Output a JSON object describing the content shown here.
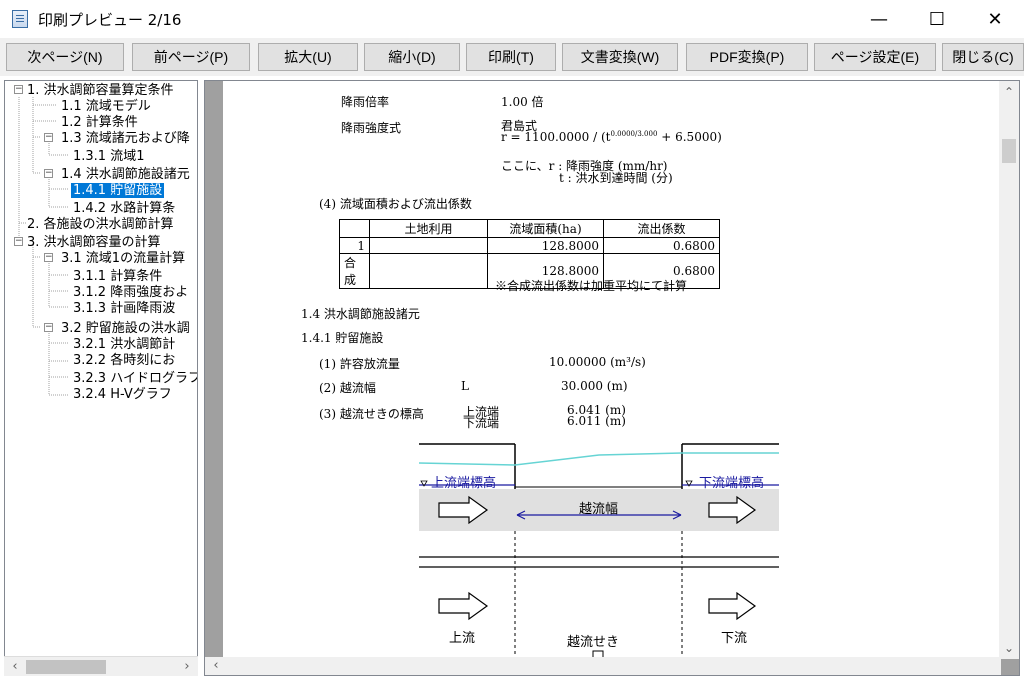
{
  "window": {
    "title": "印刷プレビュー 2/16",
    "controls": {
      "minimize": "—",
      "maximize": "☐",
      "close": "✕"
    }
  },
  "toolbar": {
    "next_page": "次ページ(N)",
    "prev_page": "前ページ(P)",
    "zoom_in": "拡大(U)",
    "zoom_out": "縮小(D)",
    "print": "印刷(T)",
    "doc_convert": "文書変換(W)",
    "pdf_convert": "PDF変換(P)",
    "page_setup": "ページ設定(E)",
    "close": "閉じる(C)"
  },
  "tree": {
    "items": [
      {
        "label": "1. 洪水調節容量算定条件"
      },
      {
        "label": "1.1 流域モデル"
      },
      {
        "label": "1.2 計算条件"
      },
      {
        "label": "1.3 流域諸元および降"
      },
      {
        "label": "1.3.1 流域1"
      },
      {
        "label": "1.4 洪水調節施設諸元"
      },
      {
        "label": "1.4.1 貯留施設"
      },
      {
        "label": "1.4.2 水路計算条"
      },
      {
        "label": "2. 各施設の洪水調節計算"
      },
      {
        "label": "3. 洪水調節容量の計算"
      },
      {
        "label": "3.1 流域1の流量計算"
      },
      {
        "label": "3.1.1 計算条件"
      },
      {
        "label": "3.1.2 降雨強度およ"
      },
      {
        "label": "3.1.3 計画降雨波"
      },
      {
        "label": "3.2 貯留施設の洪水調"
      },
      {
        "label": "3.2.1 洪水調節計"
      },
      {
        "label": "3.2.2 各時刻にお"
      },
      {
        "label": "3.2.3 ハイドログラフ"
      },
      {
        "label": "3.2.4 H-Vグラフ"
      }
    ]
  },
  "doc": {
    "rain_ratio_label": "降雨倍率",
    "rain_ratio_value": "1.00 倍",
    "intensity_label": "降雨強度式",
    "formula_name": "君島式",
    "formula": "r = 1100.0000 / (t",
    "formula_exp": "0.0000/3.000",
    "formula_end": "+     6.5000)",
    "where_r": "ここに、r : 降雨強度 (mm/hr)",
    "where_t": "t : 洪水到達時間 (分)",
    "section4_title": "(4)  流域面積および流出係数",
    "table": {
      "headers": [
        "",
        "土地利用",
        "流域面積(ha)",
        "流出係数"
      ],
      "rows": [
        [
          "1",
          "",
          "128.8000",
          "0.6800"
        ],
        [
          "合成",
          "",
          "128.8000",
          "0.6800"
        ]
      ]
    },
    "table_note": "※合成流出係数は加重平均にて計算",
    "sec_1_4": "1.4  洪水調節施設諸元",
    "sec_1_4_1": "1.4.1 貯留施設",
    "item1_label": "(1)  許容放流量",
    "item1_value": "10.00000 (m³/s)",
    "item2_label": "(2)  越流幅",
    "item2_symbol": "L",
    "item2_value": "30.000 (m)",
    "item3_label": "(3)  越流せきの標高",
    "item3_up": "上流端",
    "item3_down": "下流端",
    "item3_up_value": "6.041 (m)",
    "item3_down_value": "6.011 (m)"
  },
  "diagram": {
    "upstream_elev": "上流端標高",
    "downstream_elev": "下流端標高",
    "weir_width": "越流幅",
    "upstream": "上流",
    "weir": "越流せき",
    "downstream": "下流"
  }
}
